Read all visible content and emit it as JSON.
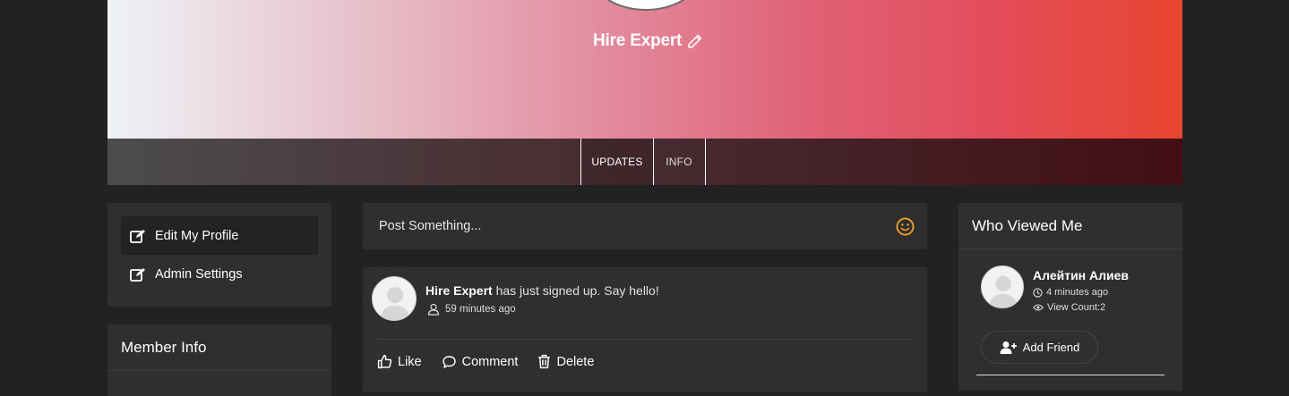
{
  "profile": {
    "name": "Hire Expert",
    "edit_icon": "pencil-icon"
  },
  "tabs": [
    {
      "label": "UPDATES",
      "active": true
    },
    {
      "label": "INFO",
      "active": false
    }
  ],
  "sidebar": {
    "items": [
      {
        "label": "Edit My Profile",
        "icon": "edit-icon",
        "active": true
      },
      {
        "label": "Admin Settings",
        "icon": "edit-icon",
        "active": false
      }
    ],
    "member_info_title": "Member Info"
  },
  "composer": {
    "placeholder": "Post Something...",
    "emoji_icon": "smiley-icon",
    "emoji_color": "#f0a02a"
  },
  "feed": {
    "items": [
      {
        "user": "Hire Expert",
        "message": " has just signed up. Say hello!",
        "time": "59 minutes ago",
        "actions": {
          "like": "Like",
          "comment": "Comment",
          "delete": "Delete"
        }
      }
    ]
  },
  "who_viewed": {
    "title": "Who Viewed Me",
    "viewers": [
      {
        "name": "Алейтин Алиев",
        "time": "4 minutes ago",
        "view_count": "View Count:2",
        "add_friend": "Add Friend"
      }
    ]
  },
  "colors": {
    "page_bg": "#222222",
    "panel_bg": "#2f2f2f",
    "cover_gradient_start": "#eef3f6",
    "cover_gradient_end": "#e8452f"
  }
}
